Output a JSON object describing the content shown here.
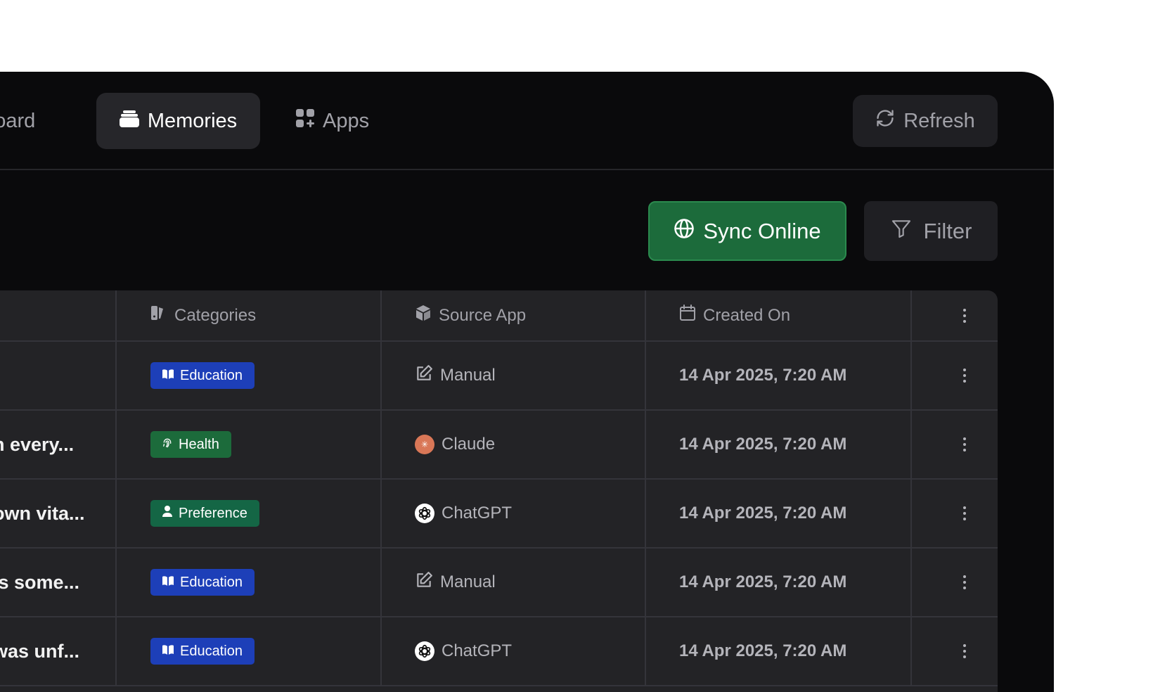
{
  "nav": {
    "items": [
      {
        "label": "hboard",
        "icon": "dashboard-icon"
      },
      {
        "label": "Memories",
        "icon": "memories-icon",
        "active": true
      },
      {
        "label": "Apps",
        "icon": "apps-icon"
      }
    ],
    "refresh_label": "Refresh"
  },
  "toolbar": {
    "sync_label": "Sync Online",
    "filter_label": "Filter"
  },
  "table": {
    "headers": {
      "categories": "Categories",
      "source_app": "Source App",
      "created_on": "Created On"
    },
    "rows": [
      {
        "memory": "",
        "category": "Education",
        "category_color": "#1d3fb8",
        "category_icon": "book-icon",
        "source": "Manual",
        "source_icon": "edit-icon",
        "created": "14 Apr 2025, 7:20 AM"
      },
      {
        "memory": "n every...",
        "category": "Health",
        "category_color": "#1c6b3b",
        "category_icon": "fingerprint-icon",
        "source": "Claude",
        "source_icon": "claude-icon",
        "created": "14 Apr 2025, 7:20 AM"
      },
      {
        "memory": "own vita...",
        "category": "Preference",
        "category_color": "#146645",
        "category_icon": "person-icon",
        "source": "ChatGPT",
        "source_icon": "chatgpt-icon",
        "created": "14 Apr 2025, 7:20 AM"
      },
      {
        "memory": "is some...",
        "category": "Education",
        "category_color": "#1d3fb8",
        "category_icon": "book-icon",
        "source": "Manual",
        "source_icon": "edit-icon",
        "created": "14 Apr 2025, 7:20 AM"
      },
      {
        "memory": "was unf...",
        "category": "Education",
        "category_color": "#1d3fb8",
        "category_icon": "book-icon",
        "source": "ChatGPT",
        "source_icon": "chatgpt-icon",
        "created": "14 Apr 2025, 7:20 AM"
      }
    ]
  },
  "colors": {
    "window_bg": "#0a0a0c",
    "table_bg": "#232326",
    "sync_green": "#1c6b3b",
    "education_blue": "#1d3fb8",
    "health_green": "#1c6b3b",
    "preference_green": "#146645",
    "claude_orange": "#d97757"
  }
}
